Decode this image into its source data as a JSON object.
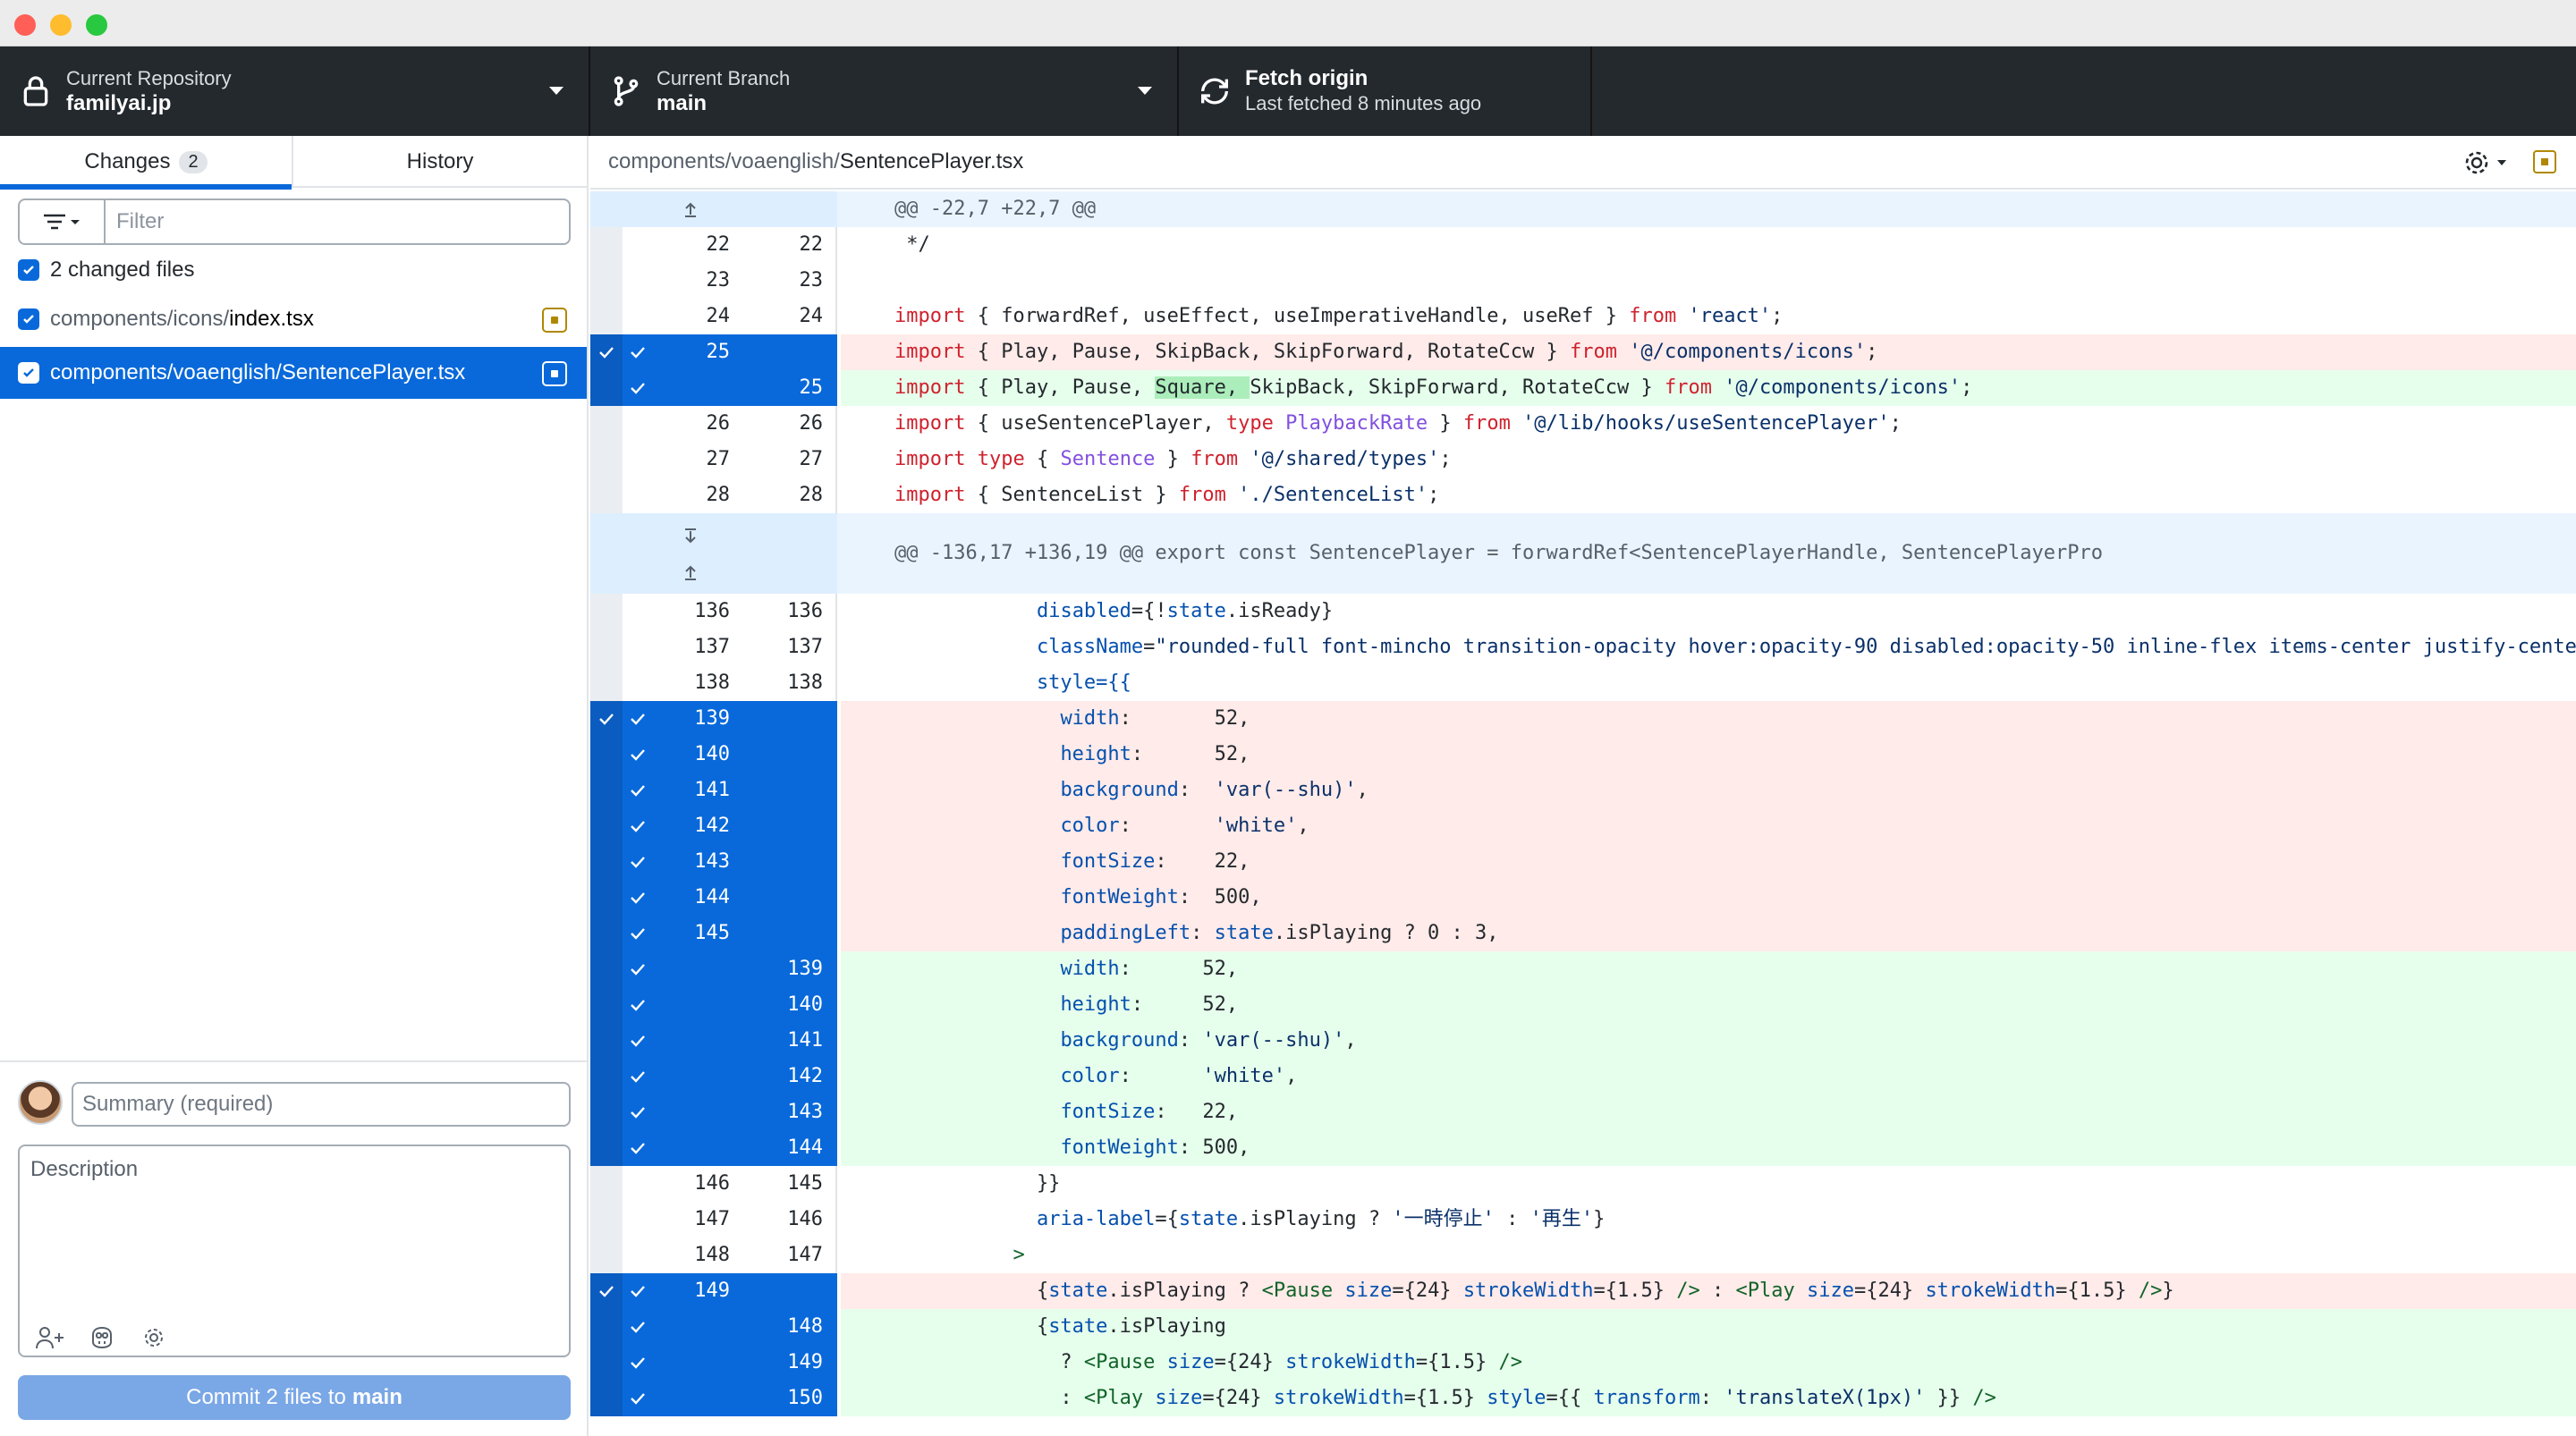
{
  "window": {
    "traffic_lights": [
      "#ff5f57",
      "#febc2e",
      "#28c840"
    ]
  },
  "toolbar": {
    "repository": {
      "label": "Current Repository",
      "value": "familyai.jp"
    },
    "branch": {
      "label": "Current Branch",
      "value": "main"
    },
    "fetch": {
      "label": "Fetch origin",
      "sub": "Last fetched 8 minutes ago"
    }
  },
  "sidebar": {
    "tabs": {
      "changes_label": "Changes",
      "changes_count": "2",
      "history_label": "History"
    },
    "filter": {
      "placeholder": "Filter"
    },
    "changed_files_label": "2 changed files",
    "files": [
      {
        "dir": "components/icons/",
        "name": "index.tsx",
        "selected": false
      },
      {
        "dir": "components/voaenglish/",
        "name": "SentencePlayer.tsx",
        "selected": true
      }
    ],
    "commit": {
      "summary_placeholder": "Summary (required)",
      "description_placeholder": "Description",
      "button_prefix": "Commit 2 files to",
      "button_branch": "main"
    }
  },
  "diff": {
    "header": {
      "dir": "components/voaenglish/",
      "name": "SentencePlayer.tsx"
    },
    "hunk1": "@@ -22,7 +22,7 @@",
    "hunk2": "@@ -136,17 +136,19 @@ export const SentencePlayer = forwardRef<SentencePlayerHandle, SentencePlayerPro",
    "colors": {
      "accent": "#0969da",
      "deleted_bg": "#ffebe9",
      "added_bg": "#e6ffec",
      "hunk_bg": "#eaf4ff"
    },
    "lines": {
      "l22": {
        "old": "22",
        "new": "22",
        "text": " */"
      },
      "l23": {
        "old": "23",
        "new": "23",
        "text": ""
      },
      "l24": {
        "old": "24",
        "new": "24"
      },
      "l25d": {
        "old": "25"
      },
      "l25a": {
        "new": "25"
      },
      "l26": {
        "old": "26",
        "new": "26"
      },
      "l27": {
        "old": "27",
        "new": "27"
      },
      "l28": {
        "old": "28",
        "new": "28"
      },
      "l136": {
        "old": "136",
        "new": "136"
      },
      "l137": {
        "old": "137",
        "new": "137"
      },
      "l138": {
        "old": "138",
        "new": "138",
        "text": "            style={{"
      },
      "d139": {
        "old": "139"
      },
      "d140": {
        "old": "140"
      },
      "d141": {
        "old": "141"
      },
      "d142": {
        "old": "142"
      },
      "d143": {
        "old": "143"
      },
      "d144": {
        "old": "144"
      },
      "d145": {
        "old": "145"
      },
      "a139": {
        "new": "139"
      },
      "a140": {
        "new": "140"
      },
      "a141": {
        "new": "141"
      },
      "a142": {
        "new": "142"
      },
      "a143": {
        "new": "143"
      },
      "a144": {
        "new": "144"
      },
      "l146": {
        "old": "146",
        "new": "145",
        "text": "            }}"
      },
      "l147": {
        "old": "147",
        "new": "146"
      },
      "l148": {
        "old": "148",
        "new": "147",
        "text": "          >"
      },
      "d149": {
        "old": "149"
      },
      "a148": {
        "new": "148"
      },
      "a149": {
        "new": "149"
      },
      "a150": {
        "new": "150"
      }
    }
  }
}
